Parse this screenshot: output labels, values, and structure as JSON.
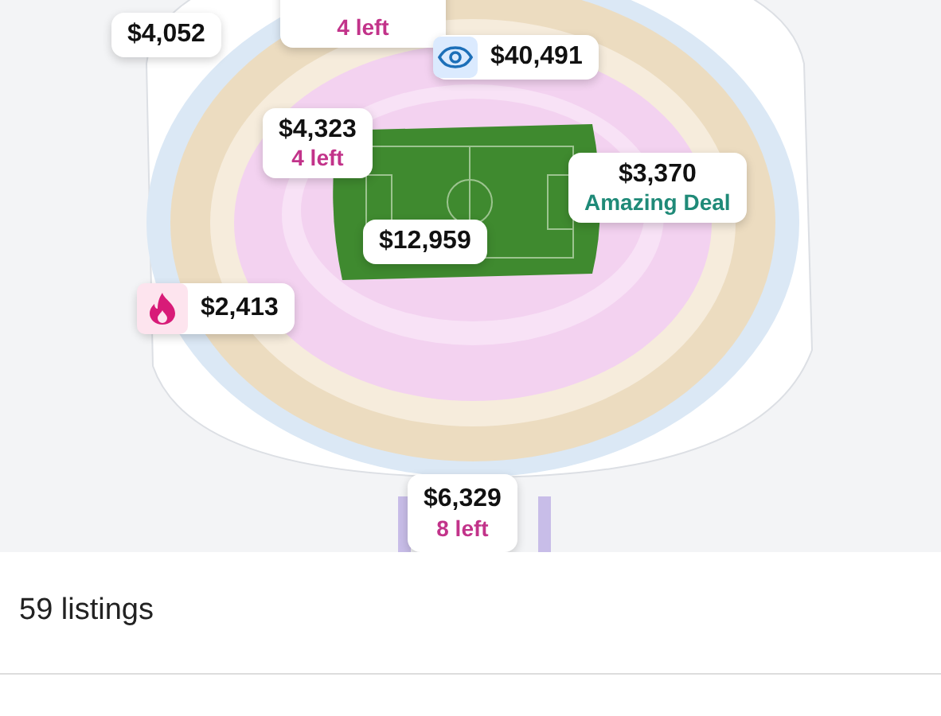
{
  "map_pins": [
    {
      "price": "$4,052"
    },
    {
      "note": {
        "text": "4 left",
        "kind": "left"
      }
    },
    {
      "price": "$40,491",
      "kind": "watched"
    },
    {
      "price": "$4,323",
      "note": {
        "text": "4 left",
        "kind": "left"
      }
    },
    {
      "price": "$3,370",
      "note": {
        "text": "Amazing Deal",
        "kind": "deal"
      }
    },
    {
      "price": "$12,959"
    },
    {
      "price": "$2,413",
      "kind": "hot"
    },
    {
      "price": "$6,329",
      "note": {
        "text": "8 left",
        "kind": "left"
      }
    }
  ],
  "listings": {
    "count": "59 listings"
  }
}
